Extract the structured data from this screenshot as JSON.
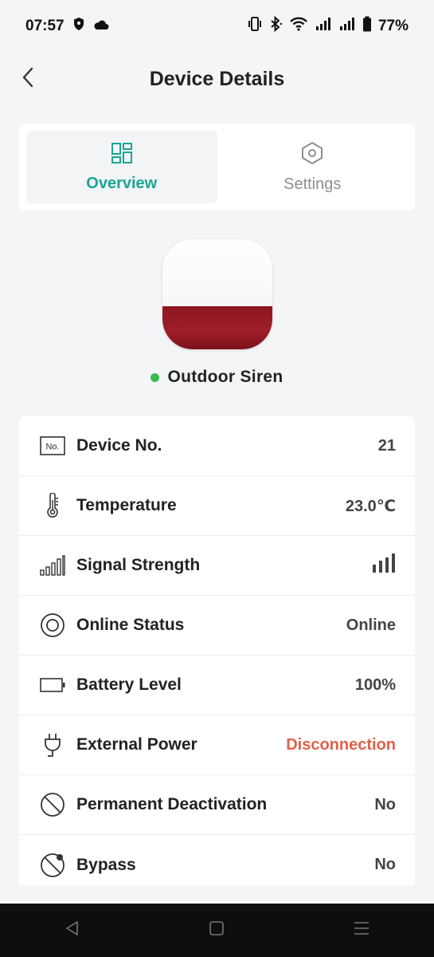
{
  "status_bar": {
    "time": "07:57",
    "battery": "77%"
  },
  "header": {
    "title": "Device Details"
  },
  "tabs": [
    {
      "label": "Overview",
      "active": true
    },
    {
      "label": "Settings",
      "active": false
    }
  ],
  "device": {
    "name": "Outdoor Siren",
    "status_color": "#3cba54"
  },
  "info_rows": [
    {
      "label": "Device No.",
      "value": "21",
      "icon": "device-number-icon"
    },
    {
      "label": "Temperature",
      "value": "23.0℃",
      "icon": "thermometer-icon"
    },
    {
      "label": "Signal Strength",
      "value": "",
      "icon": "signal-strength-icon"
    },
    {
      "label": "Online Status",
      "value": "Online",
      "icon": "online-status-icon"
    },
    {
      "label": "Battery Level",
      "value": "100%",
      "icon": "battery-icon"
    },
    {
      "label": "External Power",
      "value": "Disconnection",
      "icon": "power-plug-icon"
    },
    {
      "label": "Permanent Deactivation",
      "value": "No",
      "icon": "deactivation-icon"
    },
    {
      "label": "Bypass",
      "value": "No",
      "icon": "bypass-icon"
    }
  ],
  "colors": {
    "accent": "#1aa595",
    "warning": "#e0604a"
  }
}
